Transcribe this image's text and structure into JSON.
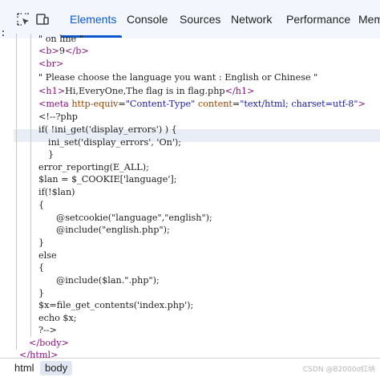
{
  "toolbar": {
    "tabs": [
      {
        "label": "Elements",
        "active": true
      },
      {
        "label": "Console",
        "active": false
      },
      {
        "label": "Sources",
        "active": false
      },
      {
        "label": "Network",
        "active": false
      },
      {
        "label": "Performance",
        "active": false
      },
      {
        "label": "Mem",
        "active": false
      }
    ],
    "icons": [
      "inspect-element-icon",
      "device-toolbar-icon"
    ]
  },
  "gutter": ":",
  "source": {
    "l01": "\" on line \"",
    "l02_open": "<b>",
    "l02_text": "9",
    "l02_close": "</b>",
    "l03": "<br>",
    "l04": "\" Please choose the language you want : English or Chinese \"",
    "l05_open": "<h1>",
    "l05_text": "Hi,EveryOne,The flag is in flag.php",
    "l05_close": "</h1>",
    "l06_tag_open": "<meta",
    "l06_attr1_name": "http-equiv",
    "l06_attr1_value": "\"Content-Type\"",
    "l06_attr2_name": "content",
    "l06_attr2_value": "\"text/html; charset=utf-8\"",
    "l06_tag_close": ">",
    "l07": "<!--?php",
    "l08": "if( !ini_get('display_errors') ) {",
    "l09": "ini_set('display_errors', 'On');",
    "l10": "}",
    "l11": "error_reporting(E_ALL);",
    "l12": "$lan = $_COOKIE['language'];",
    "l13": "if(!$lan)",
    "l14": "{",
    "l15": "@setcookie(\"language\",\"english\");",
    "l16": "@include(\"english.php\");",
    "l17": "}",
    "l18": "else",
    "l19": "{",
    "l20": "@include($lan.\".php\");",
    "l21": "}",
    "l22": "$x=file_get_contents('index.php');",
    "l23": "echo $x;",
    "l24": "?-->",
    "l25": "</body>",
    "l26": "</html>"
  },
  "breadcrumbs": [
    {
      "label": "html",
      "active": false
    },
    {
      "label": "body",
      "active": true
    }
  ],
  "watermark": "CSDN @B2000ơ红纳",
  "colors": {
    "accent": "#0b57d0",
    "tag": "#881280",
    "attr_name": "#994500",
    "attr_value": "#1a1aa6",
    "comment": "#236e25"
  }
}
